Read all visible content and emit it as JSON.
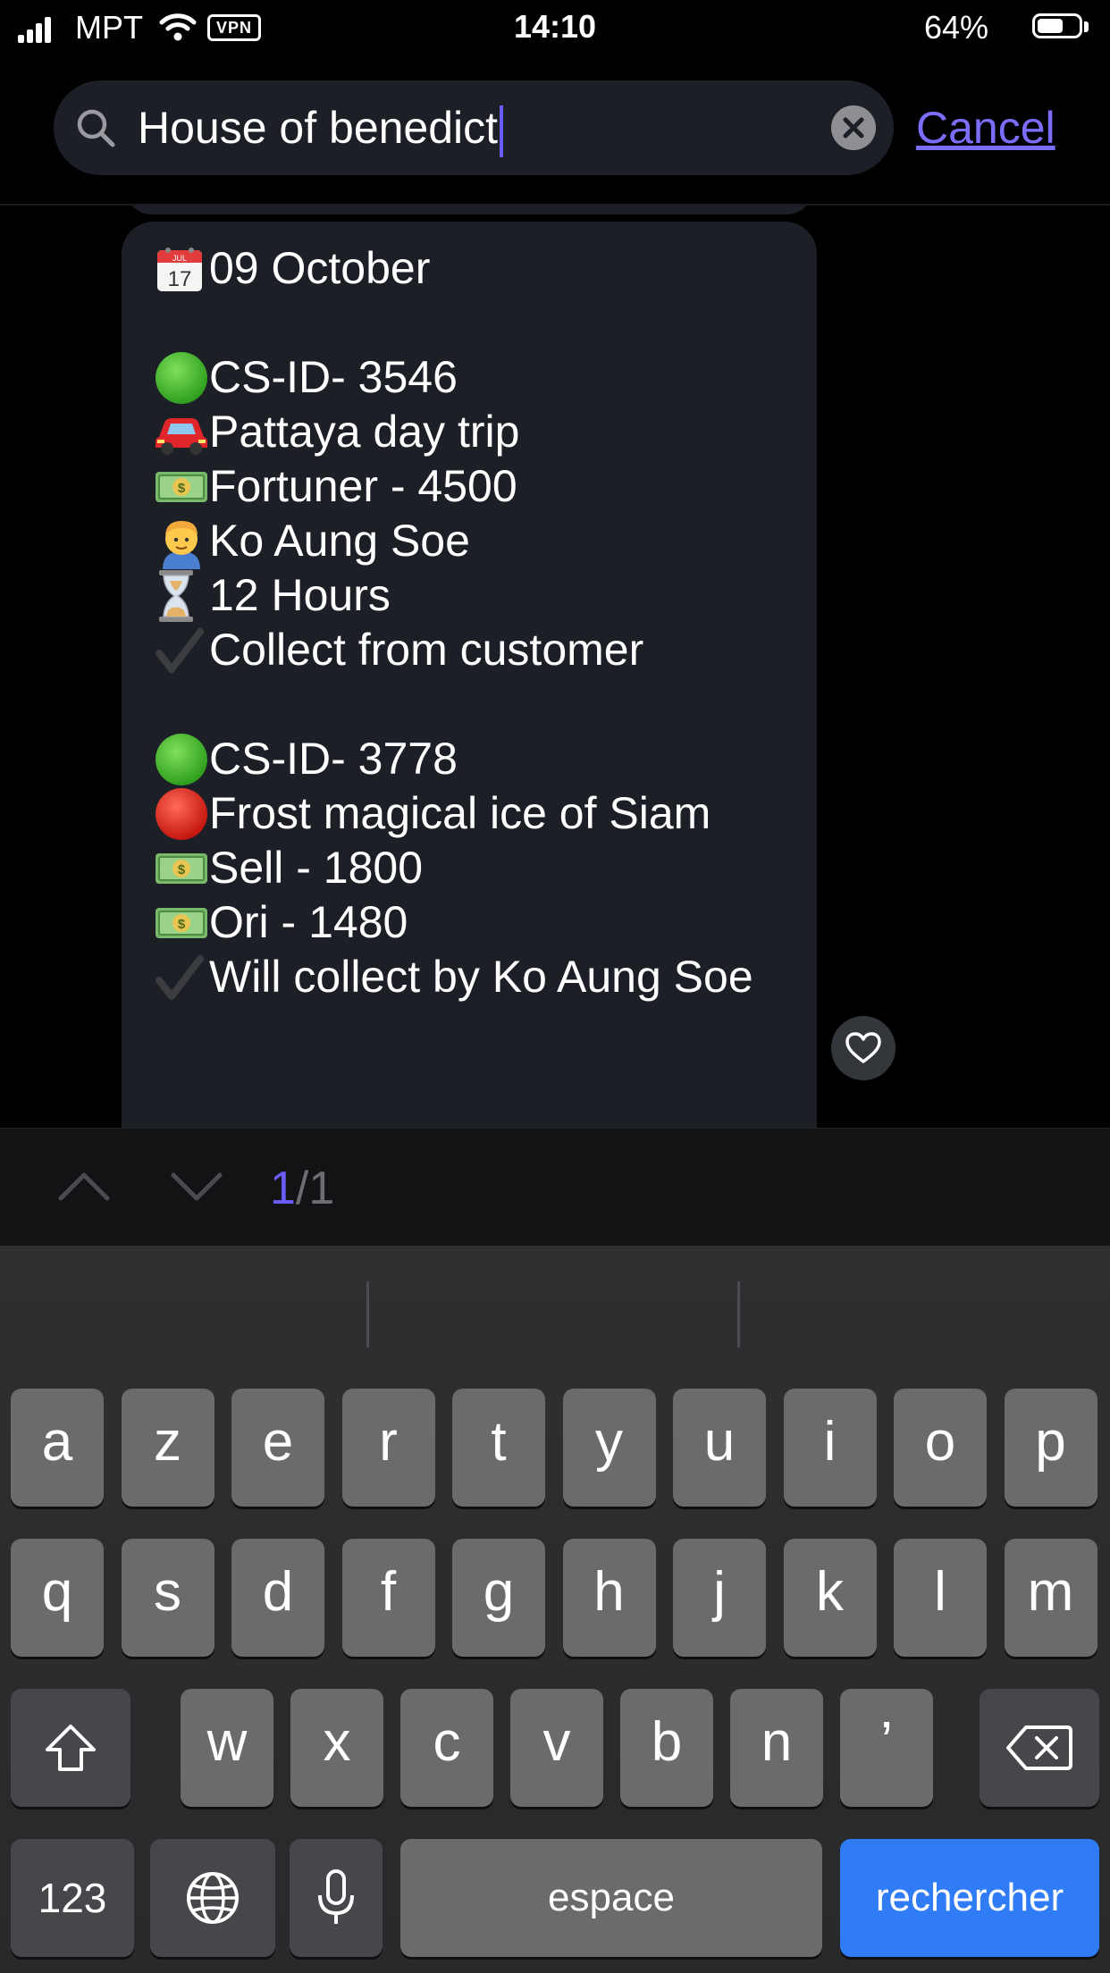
{
  "status_bar": {
    "carrier": "MPT",
    "vpn": "VPN",
    "time": "14:10",
    "battery": "64%",
    "battery_level": 0.64
  },
  "search": {
    "query": "House of benedict",
    "cancel_label": "Cancel"
  },
  "message": {
    "lines": [
      {
        "icon": "calendar-icon",
        "text": "09 October"
      },
      null,
      {
        "icon": "green-circle-icon",
        "text": "CS-ID- 3546"
      },
      {
        "icon": "car-icon",
        "text": "Pattaya day trip"
      },
      {
        "icon": "money-icon",
        "text": "Fortuner - 4500"
      },
      {
        "icon": "person-icon",
        "text": "Ko Aung Soe"
      },
      {
        "icon": "hourglass-icon",
        "text": "12 Hours"
      },
      {
        "icon": "check-icon",
        "text": "Collect from customer"
      },
      null,
      {
        "icon": "green-circle-icon",
        "text": "CS-ID- 3778"
      },
      {
        "icon": "red-circle-icon",
        "text": "Frost magical ice of Siam"
      },
      {
        "icon": "money-icon",
        "text": "Sell - 1800"
      },
      {
        "icon": "money-icon",
        "text": "Ori - 1480"
      },
      {
        "icon": "check-icon",
        "text": "Will collect by Ko Aung Soe"
      }
    ],
    "calendar_icon_text": {
      "month": "JUL",
      "day": "17"
    }
  },
  "result_nav": {
    "current": "1",
    "separator": "/",
    "total": "1"
  },
  "keyboard": {
    "row1": [
      "a",
      "z",
      "e",
      "r",
      "t",
      "y",
      "u",
      "i",
      "o",
      "p"
    ],
    "row2": [
      "q",
      "s",
      "d",
      "f",
      "g",
      "h",
      "j",
      "k",
      "l",
      "m"
    ],
    "row3": [
      "w",
      "x",
      "c",
      "v",
      "b",
      "n",
      "’"
    ],
    "numbers_label": "123",
    "space_label": "espace",
    "search_label": "rechercher"
  },
  "colors": {
    "accent": "#6b5cff",
    "bubble": "#1c1f26",
    "key": "#6b6b6e",
    "key_dark": "#46474a",
    "search_key": "#2f7cf6"
  }
}
